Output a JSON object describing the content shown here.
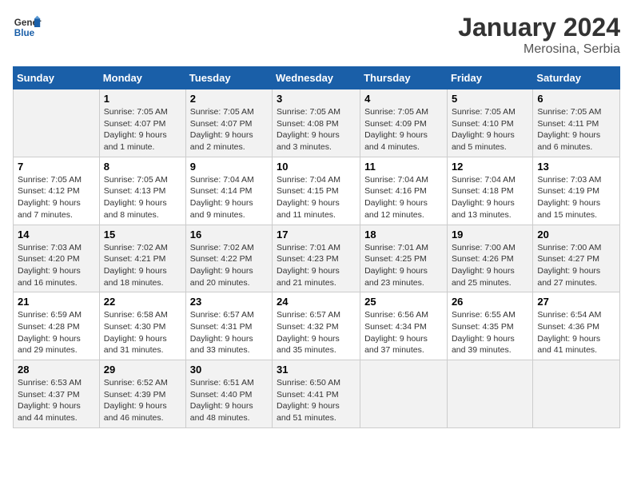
{
  "header": {
    "logo_line1": "General",
    "logo_line2": "Blue",
    "title": "January 2024",
    "subtitle": "Merosina, Serbia"
  },
  "calendar": {
    "days_of_week": [
      "Sunday",
      "Monday",
      "Tuesday",
      "Wednesday",
      "Thursday",
      "Friday",
      "Saturday"
    ],
    "weeks": [
      [
        {
          "day": "",
          "info": ""
        },
        {
          "day": "1",
          "info": "Sunrise: 7:05 AM\nSunset: 4:07 PM\nDaylight: 9 hours\nand 1 minute."
        },
        {
          "day": "2",
          "info": "Sunrise: 7:05 AM\nSunset: 4:07 PM\nDaylight: 9 hours\nand 2 minutes."
        },
        {
          "day": "3",
          "info": "Sunrise: 7:05 AM\nSunset: 4:08 PM\nDaylight: 9 hours\nand 3 minutes."
        },
        {
          "day": "4",
          "info": "Sunrise: 7:05 AM\nSunset: 4:09 PM\nDaylight: 9 hours\nand 4 minutes."
        },
        {
          "day": "5",
          "info": "Sunrise: 7:05 AM\nSunset: 4:10 PM\nDaylight: 9 hours\nand 5 minutes."
        },
        {
          "day": "6",
          "info": "Sunrise: 7:05 AM\nSunset: 4:11 PM\nDaylight: 9 hours\nand 6 minutes."
        }
      ],
      [
        {
          "day": "7",
          "info": "Sunrise: 7:05 AM\nSunset: 4:12 PM\nDaylight: 9 hours\nand 7 minutes."
        },
        {
          "day": "8",
          "info": "Sunrise: 7:05 AM\nSunset: 4:13 PM\nDaylight: 9 hours\nand 8 minutes."
        },
        {
          "day": "9",
          "info": "Sunrise: 7:04 AM\nSunset: 4:14 PM\nDaylight: 9 hours\nand 9 minutes."
        },
        {
          "day": "10",
          "info": "Sunrise: 7:04 AM\nSunset: 4:15 PM\nDaylight: 9 hours\nand 11 minutes."
        },
        {
          "day": "11",
          "info": "Sunrise: 7:04 AM\nSunset: 4:16 PM\nDaylight: 9 hours\nand 12 minutes."
        },
        {
          "day": "12",
          "info": "Sunrise: 7:04 AM\nSunset: 4:18 PM\nDaylight: 9 hours\nand 13 minutes."
        },
        {
          "day": "13",
          "info": "Sunrise: 7:03 AM\nSunset: 4:19 PM\nDaylight: 9 hours\nand 15 minutes."
        }
      ],
      [
        {
          "day": "14",
          "info": "Sunrise: 7:03 AM\nSunset: 4:20 PM\nDaylight: 9 hours\nand 16 minutes."
        },
        {
          "day": "15",
          "info": "Sunrise: 7:02 AM\nSunset: 4:21 PM\nDaylight: 9 hours\nand 18 minutes."
        },
        {
          "day": "16",
          "info": "Sunrise: 7:02 AM\nSunset: 4:22 PM\nDaylight: 9 hours\nand 20 minutes."
        },
        {
          "day": "17",
          "info": "Sunrise: 7:01 AM\nSunset: 4:23 PM\nDaylight: 9 hours\nand 21 minutes."
        },
        {
          "day": "18",
          "info": "Sunrise: 7:01 AM\nSunset: 4:25 PM\nDaylight: 9 hours\nand 23 minutes."
        },
        {
          "day": "19",
          "info": "Sunrise: 7:00 AM\nSunset: 4:26 PM\nDaylight: 9 hours\nand 25 minutes."
        },
        {
          "day": "20",
          "info": "Sunrise: 7:00 AM\nSunset: 4:27 PM\nDaylight: 9 hours\nand 27 minutes."
        }
      ],
      [
        {
          "day": "21",
          "info": "Sunrise: 6:59 AM\nSunset: 4:28 PM\nDaylight: 9 hours\nand 29 minutes."
        },
        {
          "day": "22",
          "info": "Sunrise: 6:58 AM\nSunset: 4:30 PM\nDaylight: 9 hours\nand 31 minutes."
        },
        {
          "day": "23",
          "info": "Sunrise: 6:57 AM\nSunset: 4:31 PM\nDaylight: 9 hours\nand 33 minutes."
        },
        {
          "day": "24",
          "info": "Sunrise: 6:57 AM\nSunset: 4:32 PM\nDaylight: 9 hours\nand 35 minutes."
        },
        {
          "day": "25",
          "info": "Sunrise: 6:56 AM\nSunset: 4:34 PM\nDaylight: 9 hours\nand 37 minutes."
        },
        {
          "day": "26",
          "info": "Sunrise: 6:55 AM\nSunset: 4:35 PM\nDaylight: 9 hours\nand 39 minutes."
        },
        {
          "day": "27",
          "info": "Sunrise: 6:54 AM\nSunset: 4:36 PM\nDaylight: 9 hours\nand 41 minutes."
        }
      ],
      [
        {
          "day": "28",
          "info": "Sunrise: 6:53 AM\nSunset: 4:37 PM\nDaylight: 9 hours\nand 44 minutes."
        },
        {
          "day": "29",
          "info": "Sunrise: 6:52 AM\nSunset: 4:39 PM\nDaylight: 9 hours\nand 46 minutes."
        },
        {
          "day": "30",
          "info": "Sunrise: 6:51 AM\nSunset: 4:40 PM\nDaylight: 9 hours\nand 48 minutes."
        },
        {
          "day": "31",
          "info": "Sunrise: 6:50 AM\nSunset: 4:41 PM\nDaylight: 9 hours\nand 51 minutes."
        },
        {
          "day": "",
          "info": ""
        },
        {
          "day": "",
          "info": ""
        },
        {
          "day": "",
          "info": ""
        }
      ]
    ]
  }
}
